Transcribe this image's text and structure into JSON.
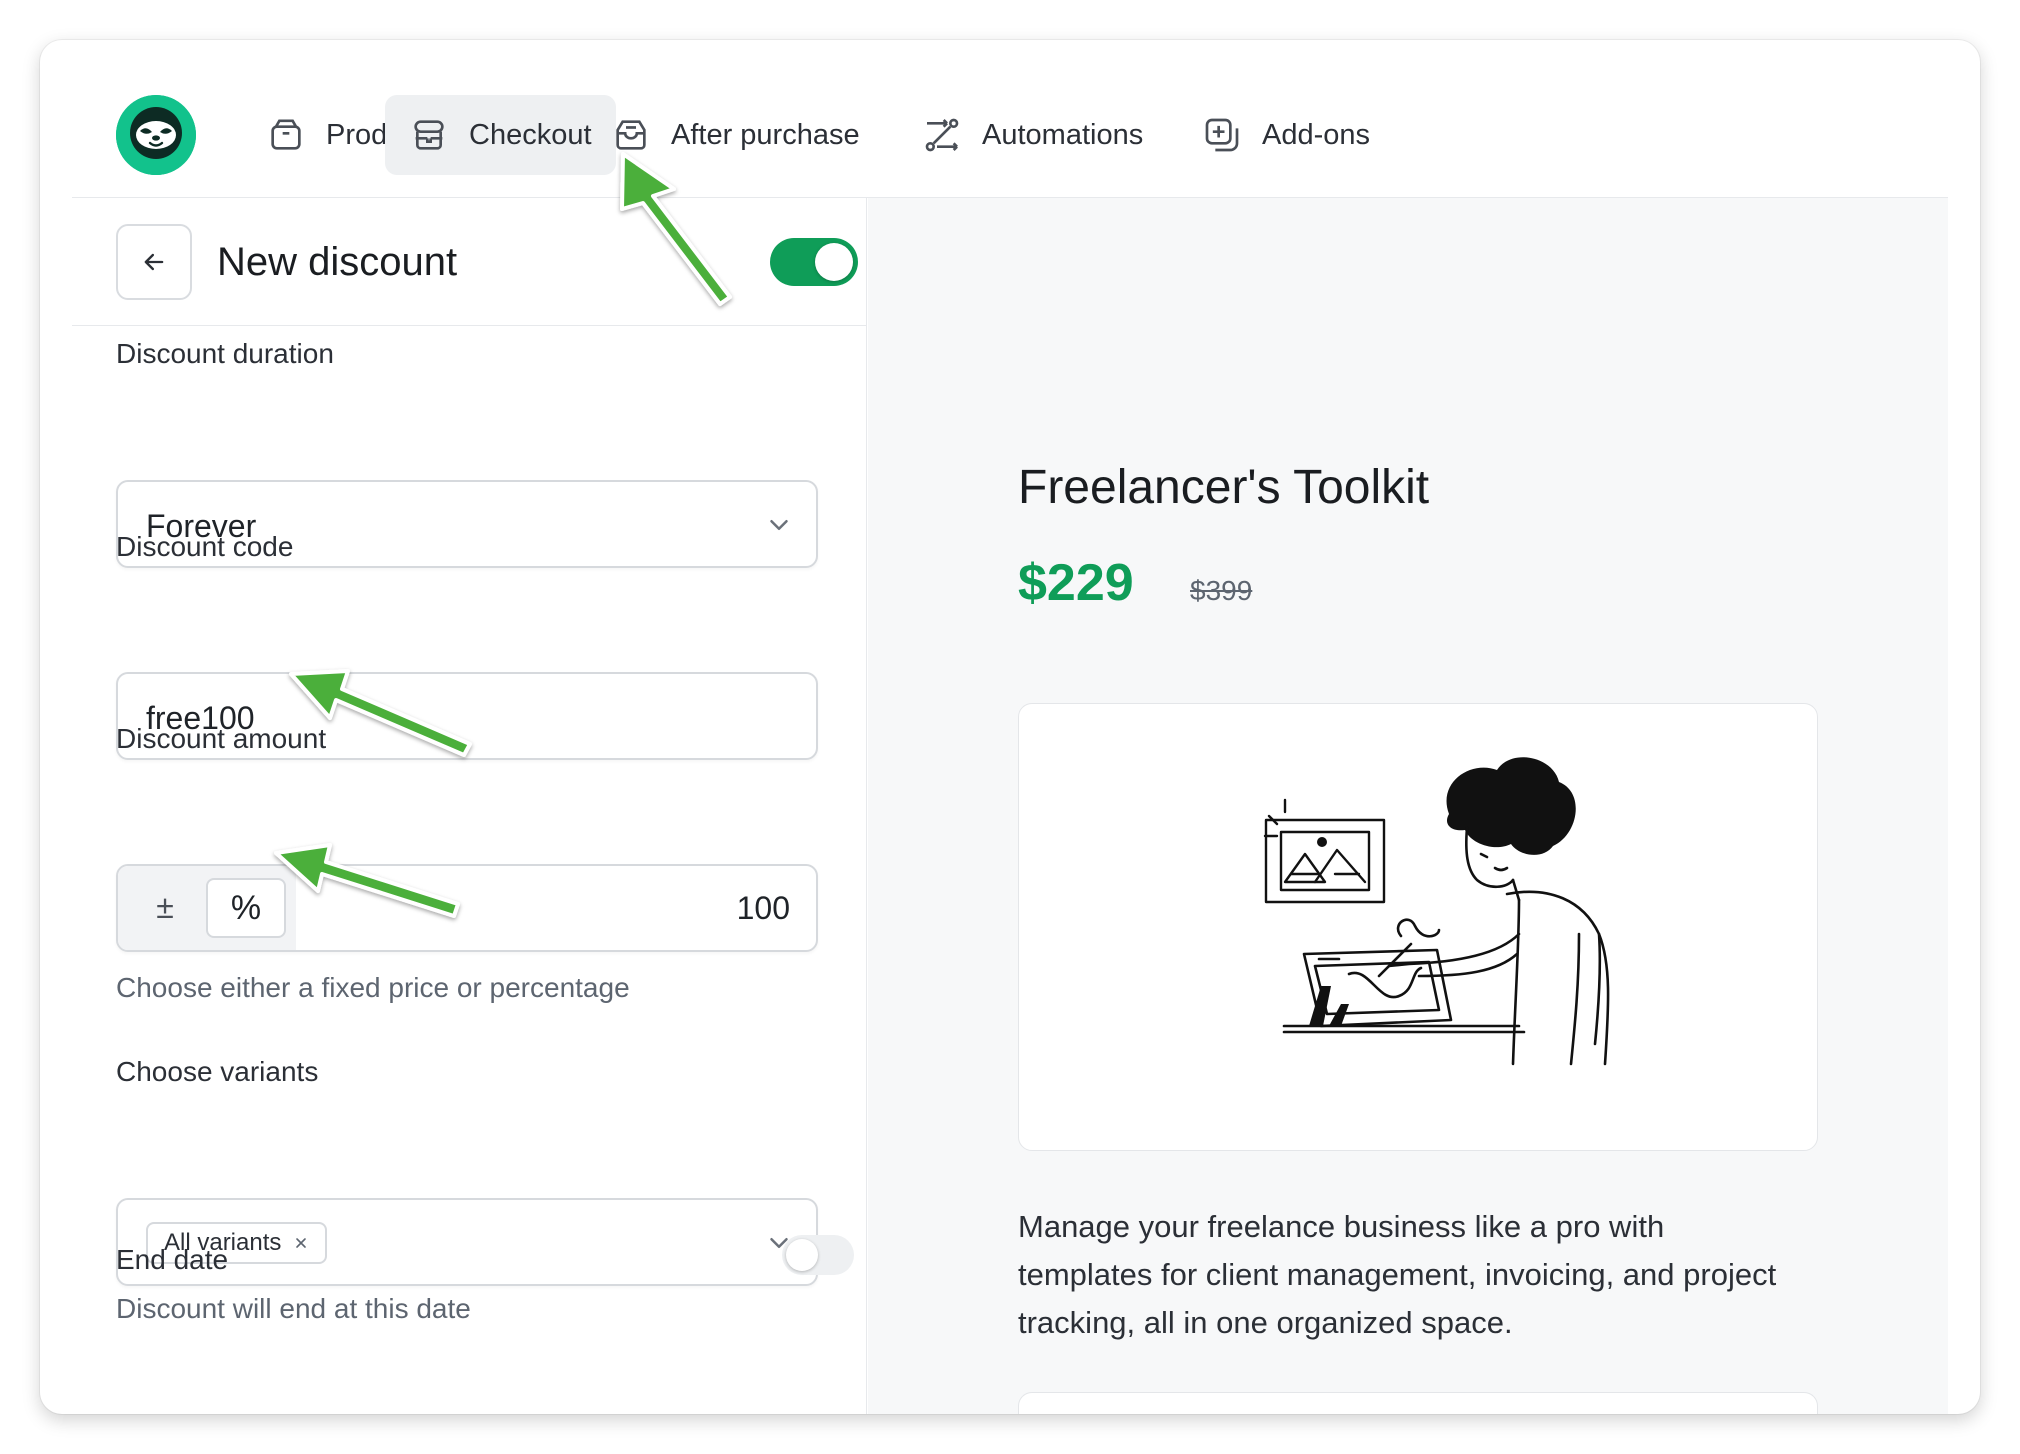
{
  "nav": {
    "items": [
      {
        "label": "Product",
        "icon": "box-icon"
      },
      {
        "label": "Checkout",
        "icon": "storefront-icon",
        "active": true
      },
      {
        "label": "After purchase",
        "icon": "inbox-icon"
      },
      {
        "label": "Automations",
        "icon": "workflow-icon"
      },
      {
        "label": "Add-ons",
        "icon": "add-square-icon"
      }
    ]
  },
  "header": {
    "title": "New discount",
    "enabled": true
  },
  "form": {
    "duration": {
      "label": "Discount duration",
      "value": "Forever"
    },
    "code": {
      "label": "Discount code",
      "value": "free100"
    },
    "amount": {
      "label": "Discount amount",
      "fixed_symbol": "±",
      "percent_symbol": "%",
      "value": "100",
      "hint": "Choose either a fixed price or percentage"
    },
    "variants": {
      "label": "Choose variants",
      "chip": "All variants"
    },
    "end_date": {
      "label": "End date",
      "hint": "Discount will end at this date",
      "enabled": false
    }
  },
  "preview": {
    "title": "Freelancer's Toolkit",
    "price": "$229",
    "old_price": "$399",
    "description": "Manage your freelance business like a pro with templates for client management, invoicing, and project tracking, all in one organized space."
  },
  "colors": {
    "brand": "#12c28c",
    "accent": "#0f9d58",
    "annotation_arrow": "#4caf3a"
  }
}
